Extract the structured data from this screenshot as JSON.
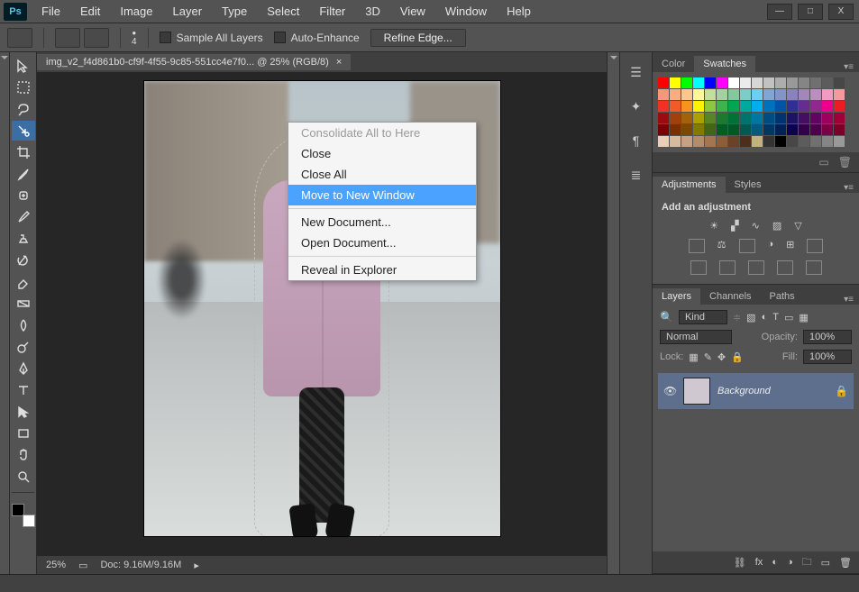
{
  "app": {
    "logo": "Ps"
  },
  "menu": [
    "File",
    "Edit",
    "Image",
    "Layer",
    "Type",
    "Select",
    "Filter",
    "3D",
    "View",
    "Window",
    "Help"
  ],
  "window_buttons": {
    "min": "—",
    "max": "□",
    "close": "X"
  },
  "options_bar": {
    "brush_size": "4",
    "sample_all_layers": "Sample All Layers",
    "auto_enhance": "Auto-Enhance",
    "refine_edge": "Refine Edge..."
  },
  "document": {
    "tab_label": "img_v2_f4d861b0-cf9f-4f55-9c85-551cc4e7f0... @ 25% (RGB/8)",
    "tab_close": "×",
    "zoom": "25%",
    "doc_size": "Doc: 9.16M/9.16M"
  },
  "context_menu": {
    "items": [
      {
        "label": "Consolidate All to Here",
        "disabled": true
      },
      {
        "label": "Close"
      },
      {
        "label": "Close All"
      },
      {
        "label": "Move to New Window",
        "highlight": true
      },
      {
        "sep": true
      },
      {
        "label": "New Document..."
      },
      {
        "label": "Open Document..."
      },
      {
        "sep": true
      },
      {
        "label": "Reveal in Explorer"
      }
    ]
  },
  "panels": {
    "color": {
      "tabs": [
        "Color",
        "Swatches"
      ],
      "active": 1
    },
    "adjustments": {
      "tabs": [
        "Adjustments",
        "Styles"
      ],
      "active": 0,
      "heading": "Add an adjustment"
    },
    "layers": {
      "tabs": [
        "Layers",
        "Channels",
        "Paths"
      ],
      "active": 0,
      "filter_label": "Kind",
      "blend_mode": "Normal",
      "opacity_label": "Opacity:",
      "opacity_value": "100%",
      "lock_label": "Lock:",
      "fill_label": "Fill:",
      "fill_value": "100%",
      "items": [
        {
          "name": "Background",
          "locked": true
        }
      ]
    }
  },
  "swatch_colors": [
    "#ff0000",
    "#ffff00",
    "#00ff00",
    "#00ffff",
    "#0000ff",
    "#ff00ff",
    "#ffffff",
    "#ebebeb",
    "#d6d6d6",
    "#c2c2c2",
    "#adadad",
    "#999999",
    "#858585",
    "#707070",
    "#5c5c5c",
    "#474747",
    "#f7977a",
    "#fbad82",
    "#fdc68c",
    "#fff79a",
    "#c4df9b",
    "#a2d39c",
    "#82ca9d",
    "#7bcdc8",
    "#6ecff6",
    "#7ea7d8",
    "#8493ca",
    "#8882be",
    "#a187be",
    "#bc8dbf",
    "#f49ac2",
    "#f6989d",
    "#ee3224",
    "#f15a29",
    "#f7941e",
    "#fff200",
    "#8dc63f",
    "#39b54a",
    "#00a651",
    "#00a99d",
    "#00aeef",
    "#0072bc",
    "#0054a6",
    "#2e3192",
    "#662d91",
    "#92278f",
    "#ec008c",
    "#ed1c24",
    "#9e0b0f",
    "#a0410d",
    "#a36209",
    "#aba000",
    "#598527",
    "#1a7b30",
    "#007236",
    "#00746b",
    "#0076a3",
    "#004b80",
    "#003471",
    "#1b1464",
    "#440e62",
    "#630460",
    "#9e005d",
    "#9e0039",
    "#790000",
    "#7b2e00",
    "#7d4900",
    "#827b00",
    "#406618",
    "#005e20",
    "#005826",
    "#005952",
    "#005b7f",
    "#003663",
    "#002157",
    "#0d004c",
    "#32004b",
    "#4b0049",
    "#7b0046",
    "#7b0026",
    "#e9cfb7",
    "#d7b99d",
    "#c6a283",
    "#b58c6a",
    "#a47551",
    "#8c5e37",
    "#6b4226",
    "#4c2f1b",
    "#c2b280",
    "#333333",
    "#000000",
    "#474747",
    "#5c5c5c",
    "#707070",
    "#858585",
    "#999999"
  ]
}
